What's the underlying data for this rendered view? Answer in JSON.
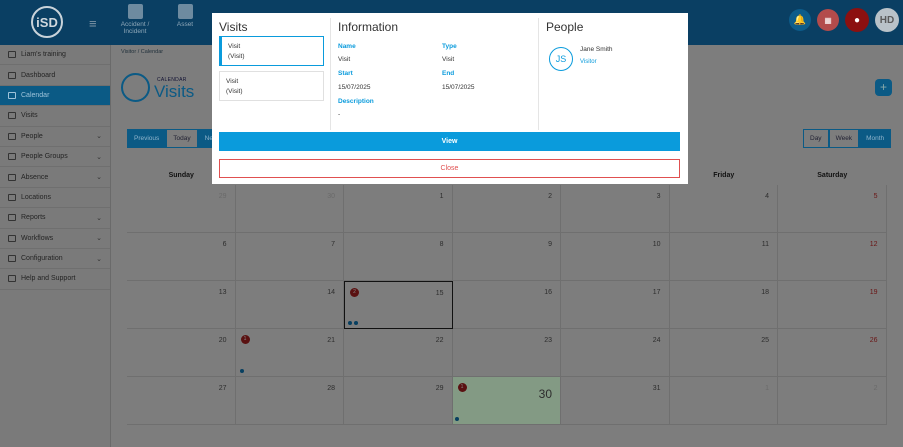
{
  "app": {
    "logo_text": "iSD",
    "user_initials": "HD"
  },
  "topnav": [
    {
      "label": "Accident / Incident",
      "icon": "first-aid-icon"
    },
    {
      "label": "Asset",
      "icon": "asset-icon"
    }
  ],
  "sidebar": {
    "items": [
      {
        "label": "Liam's training",
        "icon": "branch-icon",
        "has_chevron": false,
        "active": false
      },
      {
        "label": "Dashboard",
        "icon": "dashboard-icon",
        "has_chevron": false,
        "active": false
      },
      {
        "label": "Calendar",
        "icon": "calendar-icon",
        "has_chevron": false,
        "active": true
      },
      {
        "label": "Visits",
        "icon": "visits-icon",
        "has_chevron": false,
        "active": false
      },
      {
        "label": "People",
        "icon": "people-icon",
        "has_chevron": true,
        "active": false
      },
      {
        "label": "People Groups",
        "icon": "people-groups-icon",
        "has_chevron": true,
        "active": false
      },
      {
        "label": "Absence",
        "icon": "absence-icon",
        "has_chevron": true,
        "active": false
      },
      {
        "label": "Locations",
        "icon": "locations-icon",
        "has_chevron": false,
        "active": false
      },
      {
        "label": "Reports",
        "icon": "reports-icon",
        "has_chevron": true,
        "active": false
      },
      {
        "label": "Workflows",
        "icon": "workflows-icon",
        "has_chevron": true,
        "active": false
      },
      {
        "label": "Configuration",
        "icon": "configuration-icon",
        "has_chevron": true,
        "active": false
      },
      {
        "label": "Help and Support",
        "icon": "help-icon",
        "has_chevron": false,
        "active": false
      }
    ]
  },
  "breadcrumb": {
    "items": [
      "Visitor",
      "Calendar"
    ]
  },
  "page": {
    "small_title": "CALENDAR",
    "title": "Visits"
  },
  "calendar_controls": {
    "left": [
      "Previous",
      "Today"
    ],
    "left_truncated": "Ne",
    "right": [
      "Day",
      "Week",
      "Month"
    ],
    "active_view": "Month"
  },
  "calendar": {
    "days_of_week": [
      "Sunday",
      "",
      "",
      "",
      "",
      "Friday",
      "Saturday"
    ],
    "weeks": [
      [
        {
          "n": "29",
          "t": "other"
        },
        {
          "n": "30",
          "t": "other"
        },
        {
          "n": "1"
        },
        {
          "n": "2"
        },
        {
          "n": "3"
        },
        {
          "n": "4"
        },
        {
          "n": "5",
          "t": "red"
        }
      ],
      [
        {
          "n": "6"
        },
        {
          "n": "7"
        },
        {
          "n": "8"
        },
        {
          "n": "9"
        },
        {
          "n": "10"
        },
        {
          "n": "11"
        },
        {
          "n": "12",
          "t": "red"
        }
      ],
      [
        {
          "n": "13"
        },
        {
          "n": "14"
        },
        {
          "n": "15",
          "badge": "2",
          "dots": 2,
          "sel": true
        },
        {
          "n": "16"
        },
        {
          "n": "17"
        },
        {
          "n": "18"
        },
        {
          "n": "19",
          "t": "red"
        }
      ],
      [
        {
          "n": "20"
        },
        {
          "n": "21",
          "badge": "1"
        },
        {
          "n": "22"
        },
        {
          "n": "23"
        },
        {
          "n": "24"
        },
        {
          "n": "25"
        },
        {
          "n": "26",
          "t": "red"
        }
      ],
      [
        {
          "n": "27"
        },
        {
          "n": "28",
          "dots_prev": 1
        },
        {
          "n": "29"
        },
        {
          "n": "30",
          "badge": "1",
          "today": true
        },
        {
          "n": "31"
        },
        {
          "n": "1",
          "t": "other"
        },
        {
          "n": "2",
          "t": "other"
        }
      ]
    ]
  },
  "modal": {
    "visits_heading": "Visits",
    "information_heading": "Information",
    "people_heading": "People",
    "visit_cards": [
      {
        "title": "Visit",
        "subtitle": "(Visit)",
        "selected": true
      },
      {
        "title": "Visit",
        "subtitle": "(Visit)",
        "selected": false
      }
    ],
    "info": {
      "name_label": "Name",
      "name_value": "Visit",
      "type_label": "Type",
      "type_value": "Visit",
      "start_label": "Start",
      "start_value": "15/07/2025",
      "end_label": "End",
      "end_value": "15/07/2025",
      "description_label": "Description",
      "description_value": "-"
    },
    "person": {
      "initials": "JS",
      "name": "Jane Smith",
      "role": "Visitor"
    },
    "view_label": "View",
    "close_label": "Close"
  },
  "colors": {
    "accent": "#0a9bdc",
    "danger": "#e05050",
    "nav": "#0a3f63"
  }
}
